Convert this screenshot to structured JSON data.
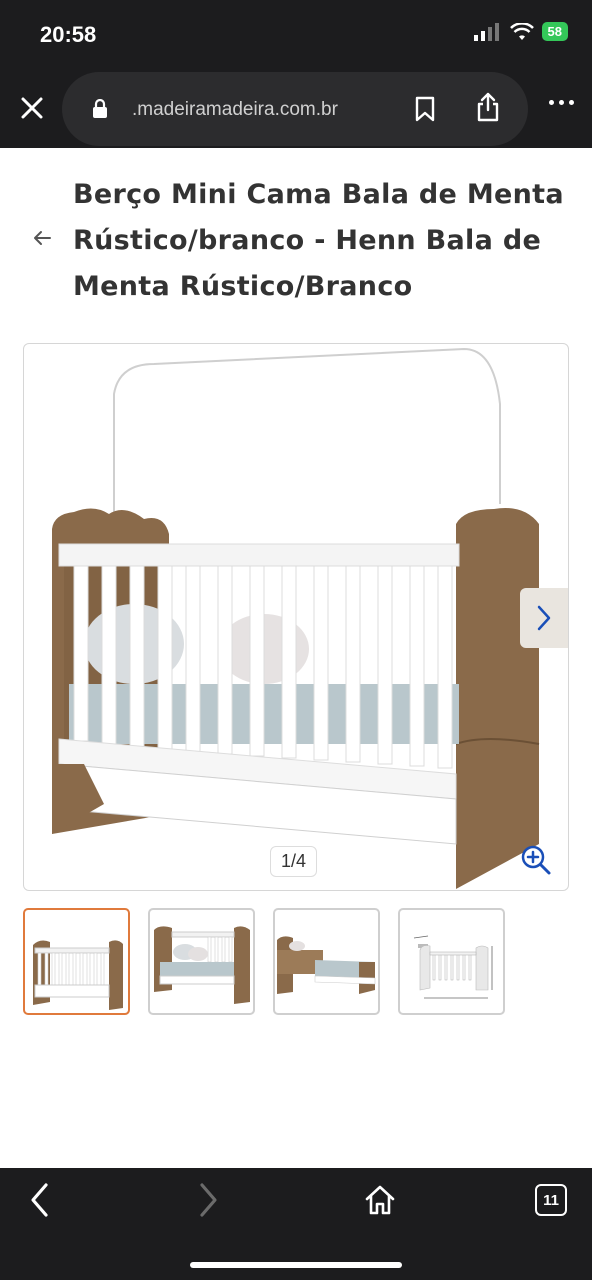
{
  "status": {
    "time": "20:58",
    "battery": "58"
  },
  "browser": {
    "url": ".madeiramadeira.com.br",
    "tab_count": "11"
  },
  "product": {
    "title": "Berço Mini Cama Bala de Menta Rústico/branco - Henn Bala de Menta Rústico/Branco",
    "image_counter": "1/4",
    "thumbnails": [
      {
        "name": "thumb-crib-front",
        "active": true
      },
      {
        "name": "thumb-crib-side",
        "active": false
      },
      {
        "name": "thumb-mini-bed",
        "active": false
      },
      {
        "name": "thumb-crib-dimensions",
        "active": false
      }
    ]
  },
  "colors": {
    "wood": "#8a6a4a",
    "accent_thumb_border": "#e07a3c",
    "zoom_blue": "#1a4fb8",
    "dark_chrome": "#1c1c1e"
  }
}
